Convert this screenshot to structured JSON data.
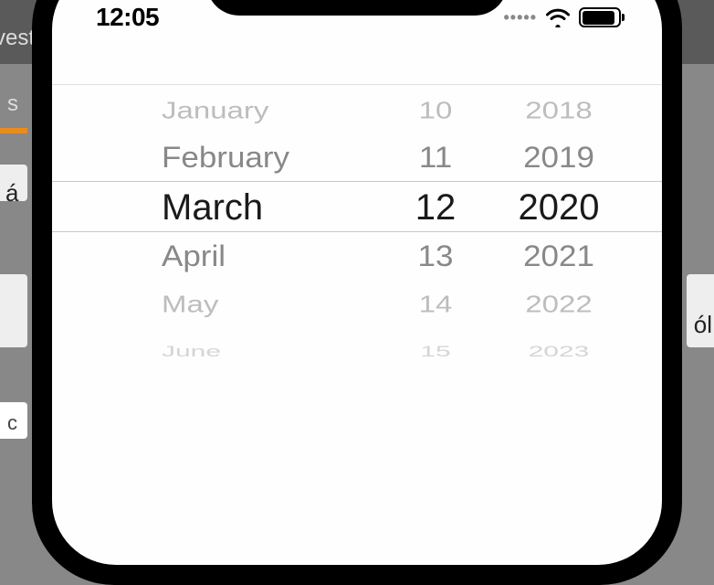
{
  "status_bar": {
    "time": "12:05",
    "cell_dots": "•••••"
  },
  "picker": {
    "months": {
      "minus2": "January",
      "minus1": "February",
      "selected": "March",
      "plus1": "April",
      "plus2": "May",
      "plus3": "June"
    },
    "days": {
      "minus2": "10",
      "minus1": "11",
      "selected": "12",
      "plus1": "13",
      "plus2": "14",
      "plus3": "15"
    },
    "years": {
      "minus2": "2018",
      "minus1": "2019",
      "selected": "2020",
      "plus1": "2021",
      "plus2": "2022",
      "plus3": "2023"
    }
  },
  "bg": {
    "vest": "vest",
    "s": "s",
    "a": "á",
    "ol": "ól",
    "c": "c"
  }
}
